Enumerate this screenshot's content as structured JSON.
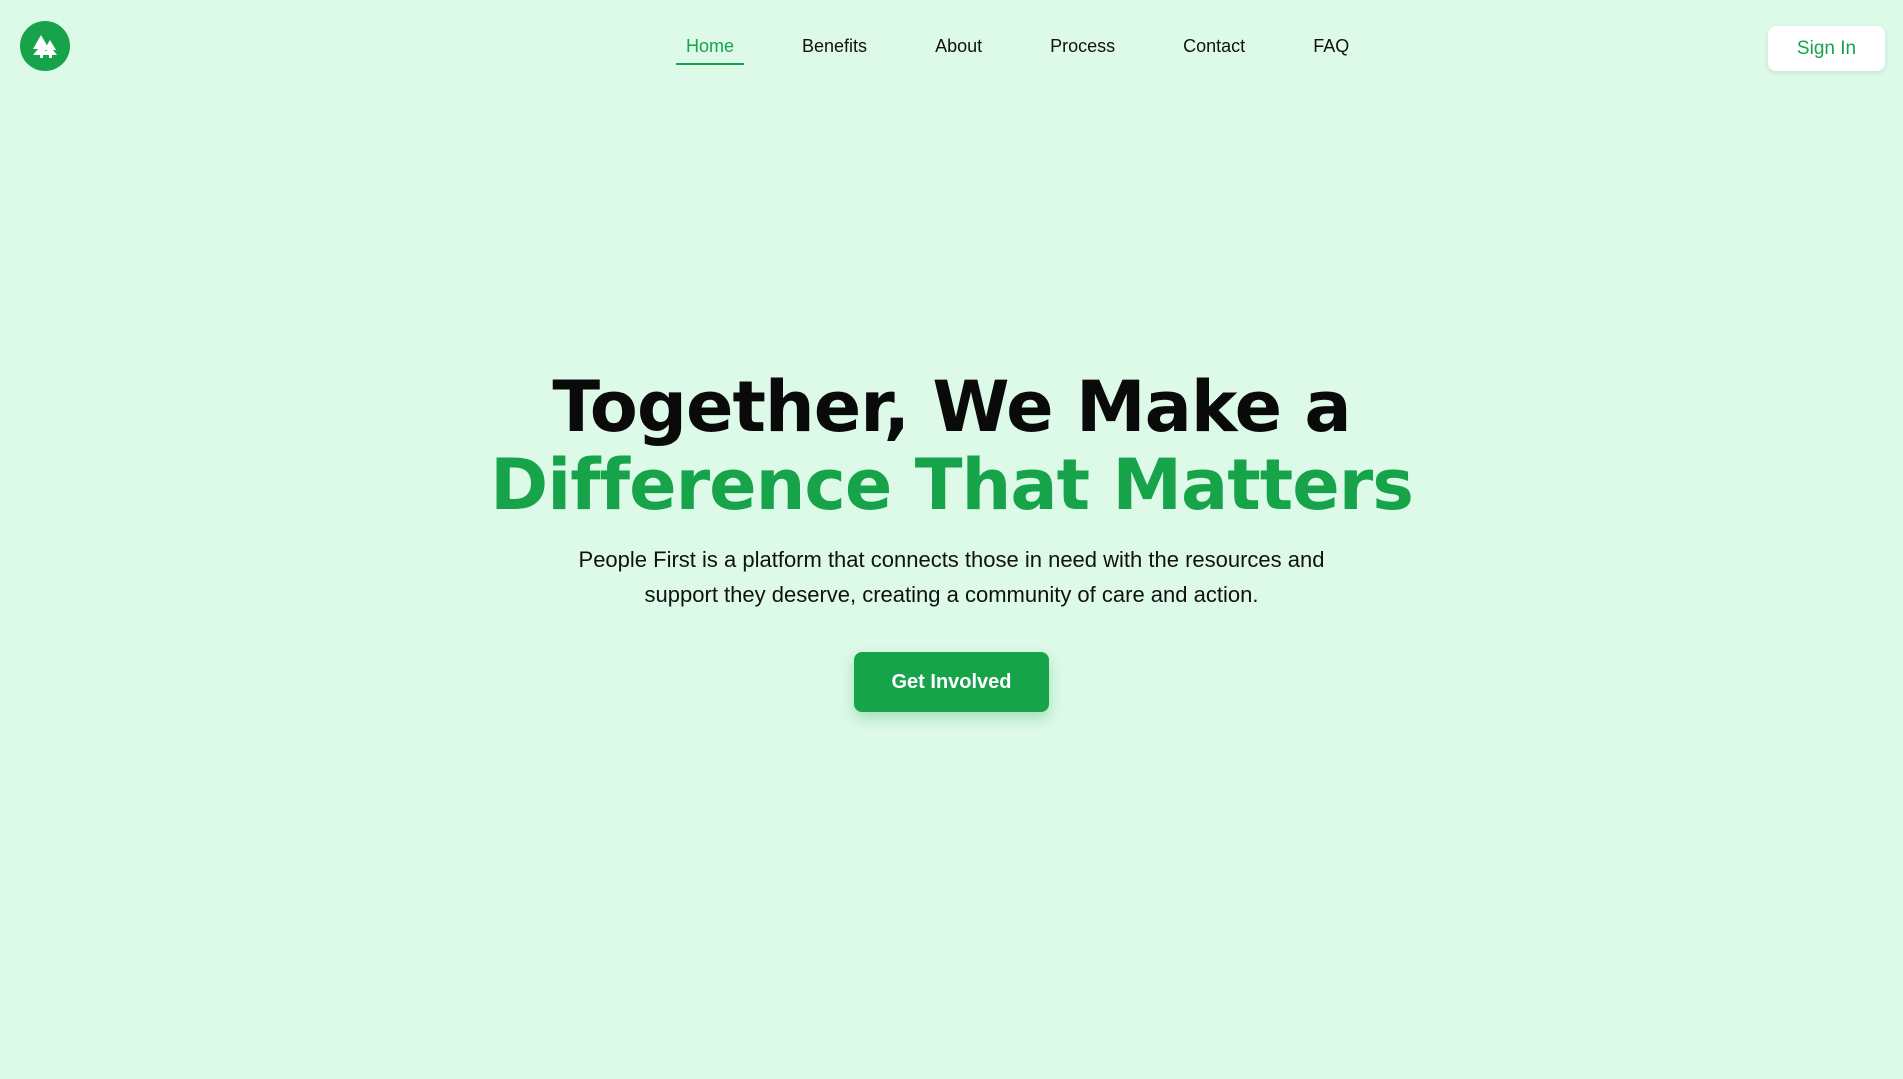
{
  "brand": {
    "logo_icon": "trees-icon",
    "accent_color": "#16a34a",
    "background_color": "#ddfae8"
  },
  "nav": {
    "items": [
      {
        "label": "Home",
        "active": true
      },
      {
        "label": "Benefits",
        "active": false
      },
      {
        "label": "About",
        "active": false
      },
      {
        "label": "Process",
        "active": false
      },
      {
        "label": "Contact",
        "active": false
      },
      {
        "label": "FAQ",
        "active": false
      }
    ]
  },
  "header": {
    "signin_label": "Sign In"
  },
  "hero": {
    "title_line1": "Together, We Make a",
    "title_line2": "Difference That Matters",
    "description": "People First is a platform that connects those in need with the resources and support they deserve, creating a community of care and action.",
    "cta_label": "Get Involved"
  }
}
